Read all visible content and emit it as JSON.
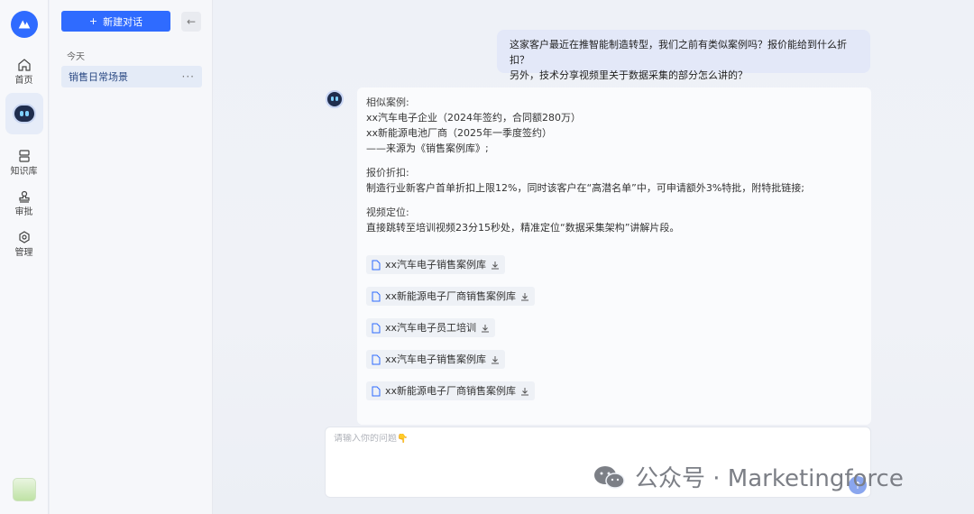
{
  "nav": {
    "items": [
      {
        "label": "首页",
        "icon": "home-icon"
      },
      {
        "label": "知识库",
        "icon": "database-icon"
      },
      {
        "label": "审批",
        "icon": "stamp-icon"
      },
      {
        "label": "管理",
        "icon": "settings-icon"
      }
    ]
  },
  "sidebar": {
    "new_chat_label": "新建对话",
    "section_today": "今天",
    "conversations": [
      {
        "title": "销售日常场景"
      }
    ]
  },
  "chat": {
    "user_message_line1": "这家客户最近在推智能制造转型，我们之前有类似案例吗？报价能给到什么折扣？",
    "user_message_line2": "另外，技术分享视频里关于数据采集的部分怎么讲的？",
    "answer": {
      "cases_heading": "相似案例:",
      "case1": "xx汽车电子企业（2024年签约，合同额280万）",
      "case2": "xx新能源电池厂商（2025年一季度签约）",
      "case_source": "——来源为《销售案例库》;",
      "discount_heading": "报价折扣:",
      "discount_text": "制造行业新客户首单折扣上限12%，同时该客户在“高潜名单”中，可申请额外3%特批，附特批链接;",
      "video_heading": "视频定位:",
      "video_text": "直接跳转至培训视频23分15秒处，精准定位“数据采集架构”讲解片段。",
      "files": [
        {
          "name": "xx汽车电子销售案例库"
        },
        {
          "name": "xx新能源电子厂商销售案例库"
        },
        {
          "name": "xx汽车电子员工培训"
        },
        {
          "name": "xx汽车电子销售案例库"
        },
        {
          "name": "xx新能源电子厂商销售案例库"
        }
      ]
    },
    "input_placeholder": "请输入你的问题👇"
  },
  "watermark": {
    "text": "公众号 · Marketingforce"
  },
  "colors": {
    "accent": "#2f6bff",
    "selected_bg": "#e4ebf7",
    "user_bubble": "#e3e8f8"
  }
}
